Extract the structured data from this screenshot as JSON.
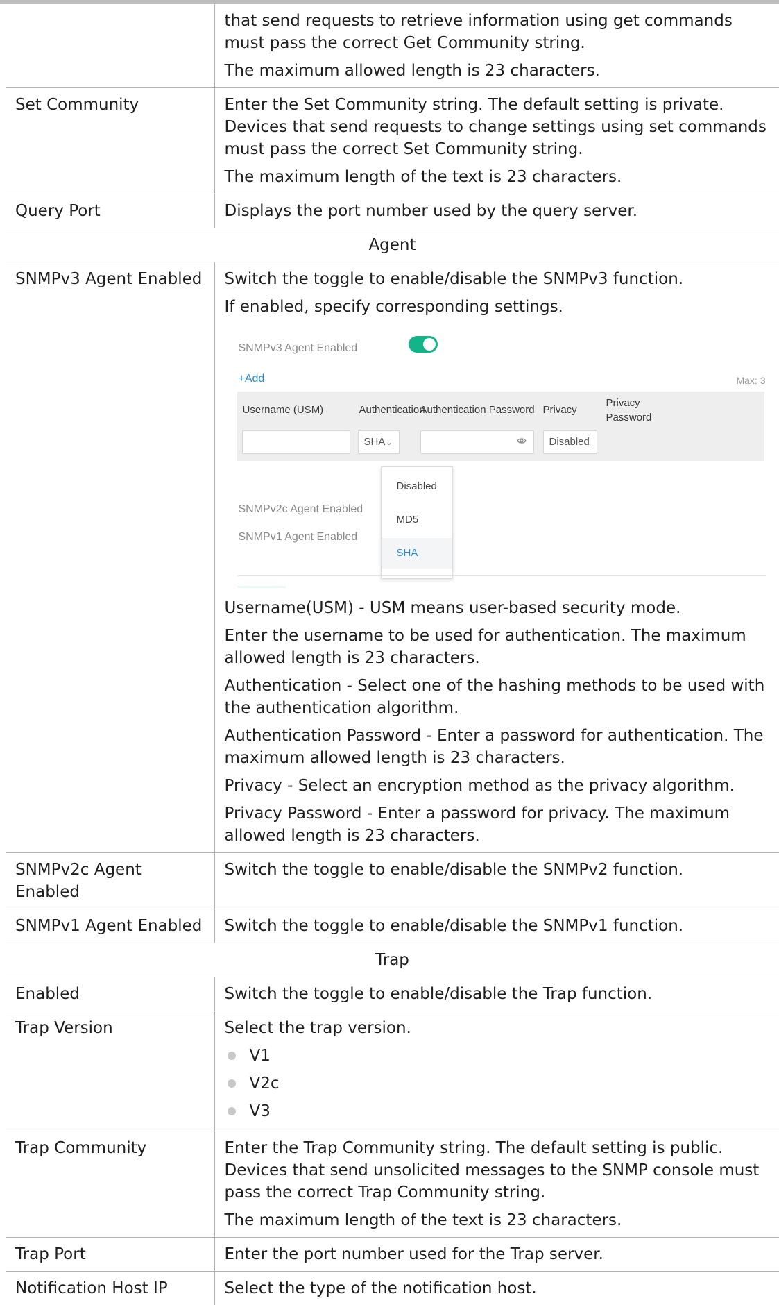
{
  "rows": [
    {
      "key": "",
      "lines": [
        "that send requests to retrieve information using get commands must pass the correct Get Community string.",
        "The maximum allowed length is 23 characters."
      ]
    },
    {
      "key": "Set Community",
      "lines": [
        "Enter the Set Community string. The default setting is private. Devices that send requests to change settings using set commands must pass the correct Set Community string.",
        "The maximum length of the text is 23 characters."
      ]
    },
    {
      "key": "Query Port",
      "lines": [
        "Displays the port number used by the query server."
      ]
    }
  ],
  "agent_section": "Agent",
  "snmpv3": {
    "key": "SNMPv3 Agent Enabled",
    "intro": [
      "Switch the toggle to enable/disable the SNMPv3 function.",
      "If enabled, specify corresponding settings."
    ],
    "details": [
      "Username(USM) - USM means user-based security mode.",
      "Enter the username to be used for authentication. The maximum allowed length is 23 characters.",
      "Authentication - Select one of the hashing methods to be used with the authentication algorithm.",
      "Authentication Password - Enter a password for authentication. The maximum allowed length is 23 characters.",
      "Privacy - Select an encryption method as the privacy algorithm.",
      "Privacy Password - Enter a password for privacy. The maximum allowed length is 23 characters."
    ]
  },
  "screenshot": {
    "toggle_label": "SNMPv3 Agent Enabled",
    "toggle_on": true,
    "toggle_color": "#14b48a",
    "add_label": "+Add",
    "max_label": "Max: 3",
    "columns": [
      "Username (USM)",
      "Authentication",
      "Authentication Password",
      "Privacy",
      "Privacy Password"
    ],
    "auth_selected": "SHA",
    "privacy_selected": "Disabled",
    "dropdown_options": [
      "Disabled",
      "MD5",
      "SHA"
    ],
    "dropdown_active": "SHA",
    "link_color": "#2a8ad0",
    "v2c_label": "SNMPv2c Agent Enabled",
    "v1_label": "SNMPv1 Agent Enabled"
  },
  "rows_after_agent": [
    {
      "key": "SNMPv2c Agent Enabled",
      "text": "Switch the toggle to enable/disable the SNMPv2 function."
    },
    {
      "key": "SNMPv1 Agent Enabled",
      "text": "Switch the toggle to enable/disable the SNMPv1 function."
    }
  ],
  "trap_section": "Trap",
  "trap_rows": {
    "enabled": {
      "key": "Enabled",
      "text": "Switch the toggle to enable/disable the Trap function."
    },
    "version": {
      "key": "Trap Version",
      "text": "Select the trap version.",
      "options": [
        "V1",
        "V2c",
        "V3"
      ]
    },
    "community": {
      "key": "Trap Community",
      "lines": [
        "Enter the Trap Community string. The default setting is public. Devices that send unsolicited messages to the SNMP console must pass the correct Trap Community string.",
        "The maximum length of the text is 23 characters."
      ]
    },
    "port": {
      "key": "Trap Port",
      "text": "Enter the port number used for the Trap server."
    },
    "host": {
      "key": "Notification Host IP",
      "text": "Select the type of the notification host."
    }
  }
}
